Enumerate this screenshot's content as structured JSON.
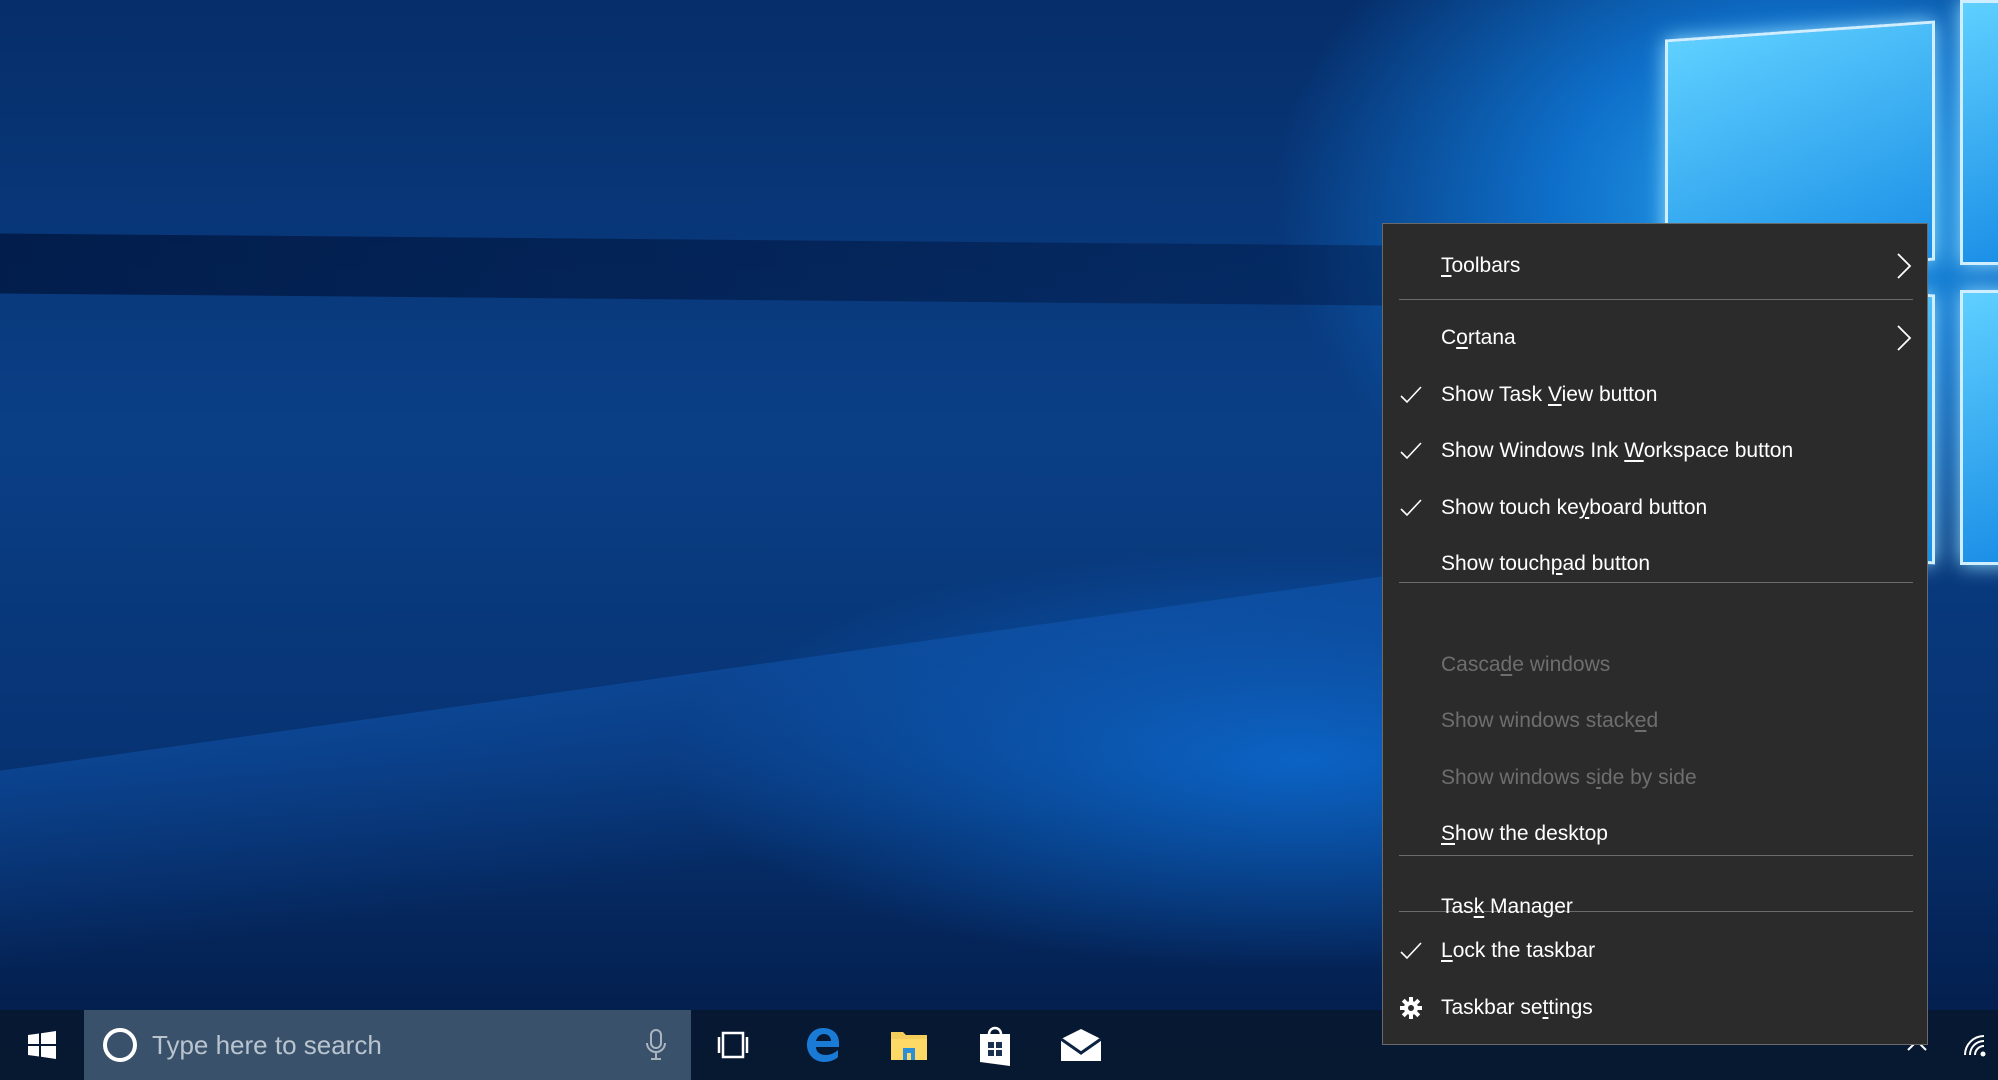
{
  "taskbar": {
    "search_placeholder": "Type here to search"
  },
  "menu": {
    "items": [
      {
        "pre": "",
        "key": "T",
        "post": "oolbars",
        "checked": false,
        "submenu": true,
        "disabled": false
      },
      {
        "pre": "C",
        "key": "o",
        "post": "rtana",
        "checked": false,
        "submenu": true,
        "disabled": false
      },
      {
        "pre": "Show Task ",
        "key": "V",
        "post": "iew button",
        "checked": true,
        "disabled": false
      },
      {
        "pre": "Show Windows Ink ",
        "key": "W",
        "post": "orkspace button",
        "checked": true,
        "disabled": false
      },
      {
        "pre": "Show touch ke",
        "key": "y",
        "post": "board button",
        "checked": true,
        "disabled": false
      },
      {
        "pre": "Show touch",
        "key": "p",
        "post": "ad button",
        "checked": false,
        "disabled": false
      },
      {
        "pre": "Casca",
        "key": "d",
        "post": "e windows",
        "checked": false,
        "disabled": true
      },
      {
        "pre": "Show windows stack",
        "key": "e",
        "post": "d",
        "checked": false,
        "disabled": true
      },
      {
        "pre": "Show windows s",
        "key": "i",
        "post": "de by side",
        "checked": false,
        "disabled": true
      },
      {
        "pre": "",
        "key": "S",
        "post": "how the desktop",
        "checked": false,
        "disabled": false
      },
      {
        "pre": "Tas",
        "key": "k",
        "post": " Manager",
        "checked": false,
        "disabled": false
      },
      {
        "pre": "",
        "key": "L",
        "post": "ock the taskbar",
        "checked": true,
        "disabled": false
      },
      {
        "pre": "Taskbar se",
        "key": "t",
        "post": "tings",
        "icon": "gear-icon",
        "disabled": false
      }
    ]
  },
  "colors": {
    "menu_bg": "#2b2b2b",
    "disabled_text": "#6e6e6e",
    "taskbar": "#081830",
    "search_bg": "#39516a"
  }
}
